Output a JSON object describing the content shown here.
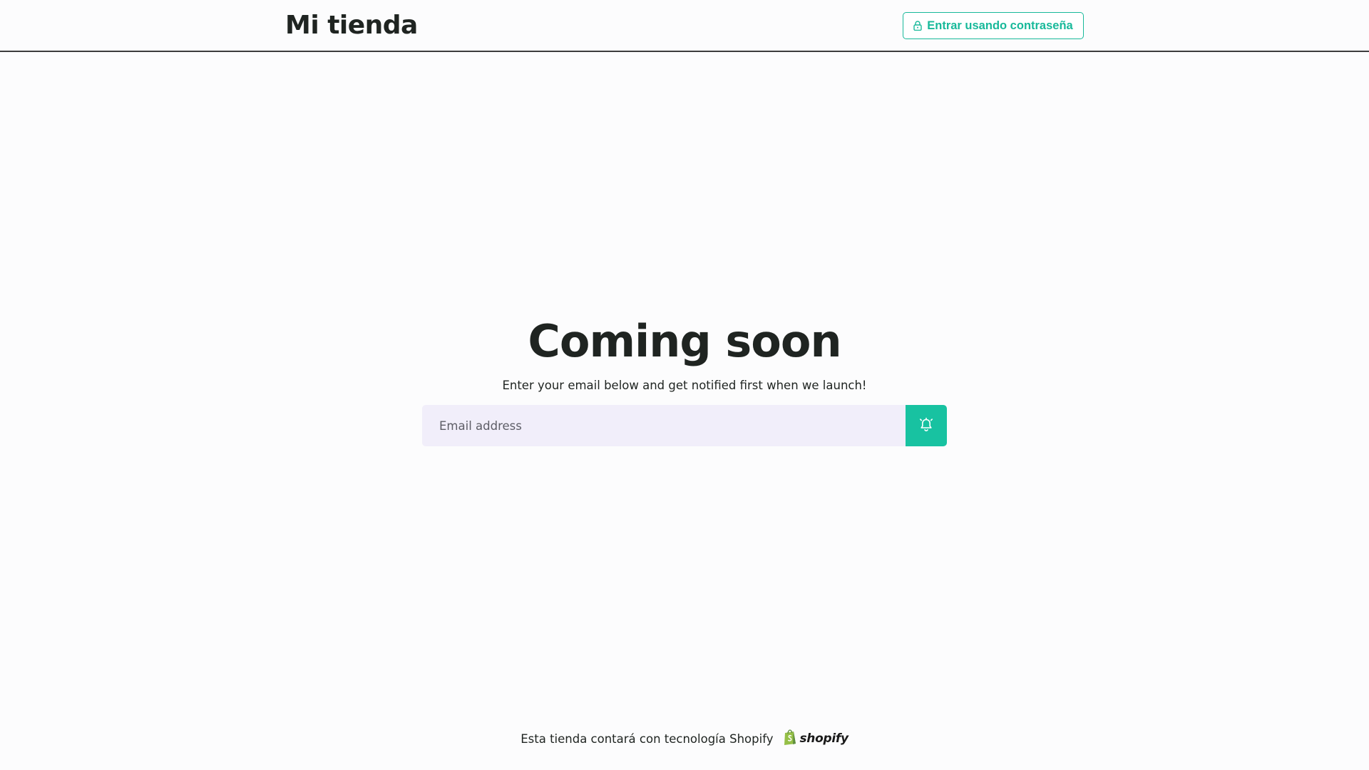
{
  "header": {
    "store_title": "Mi tienda",
    "login_label": "Entrar usando contraseña"
  },
  "main": {
    "heading": "Coming soon",
    "subtitle": "Enter your email below and get notified first when we launch!",
    "email_placeholder": "Email address",
    "email_value": ""
  },
  "footer": {
    "powered_by": "Esta tienda contará con tecnología Shopify",
    "logo_text": "shopify"
  },
  "colors": {
    "accent": "#18c2a1",
    "input_bg": "#f1eefa",
    "text": "#1f2421",
    "page_bg": "#fcfcfd"
  },
  "icons": {
    "login": "lock-icon",
    "notify": "bell-icon",
    "footer": "shopify-bag-icon"
  }
}
